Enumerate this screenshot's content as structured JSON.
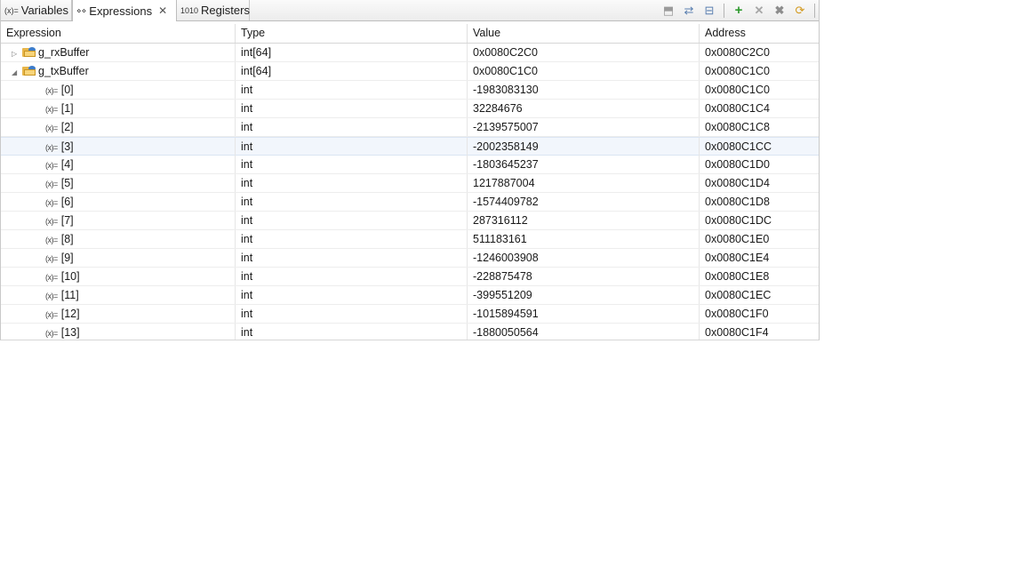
{
  "tabs": [
    {
      "label": "Variables",
      "icon": "variables-icon",
      "glyph": "(x)="
    },
    {
      "label": "Expressions",
      "icon": "expressions-icon",
      "glyph": "⋄⋄"
    },
    {
      "label": "Registers",
      "icon": "registers-icon",
      "glyph": "1010"
    }
  ],
  "toolbar_icons": [
    "collapse-all-icon",
    "show-type-names-icon",
    "collapse-icon",
    "add-expression-icon",
    "remove-icon",
    "remove-all-icon",
    "refresh-icon",
    "view-menu-icon"
  ],
  "columns": [
    "Expression",
    "Type",
    "Value",
    "Address"
  ],
  "rows": [
    {
      "expr": "g_rxBuffer",
      "type": "int[64]",
      "value": "0x0080C2C0",
      "address": "0x0080C2C0",
      "kind": "array",
      "expanded": false
    },
    {
      "expr": "g_txBuffer",
      "type": "int[64]",
      "value": "0x0080C1C0",
      "address": "0x0080C1C0",
      "kind": "array",
      "expanded": true
    },
    {
      "expr": "[0]",
      "type": "int",
      "value": "-1983083130",
      "address": "0x0080C1C0",
      "kind": "element"
    },
    {
      "expr": "[1]",
      "type": "int",
      "value": "32284676",
      "address": "0x0080C1C4",
      "kind": "element"
    },
    {
      "expr": "[2]",
      "type": "int",
      "value": "-2139575007",
      "address": "0x0080C1C8",
      "kind": "element"
    },
    {
      "expr": "[3]",
      "type": "int",
      "value": "-2002358149",
      "address": "0x0080C1CC",
      "kind": "element",
      "selected": true
    },
    {
      "expr": "[4]",
      "type": "int",
      "value": "-1803645237",
      "address": "0x0080C1D0",
      "kind": "element"
    },
    {
      "expr": "[5]",
      "type": "int",
      "value": "1217887004",
      "address": "0x0080C1D4",
      "kind": "element"
    },
    {
      "expr": "[6]",
      "type": "int",
      "value": "-1574409782",
      "address": "0x0080C1D8",
      "kind": "element"
    },
    {
      "expr": "[7]",
      "type": "int",
      "value": "287316112",
      "address": "0x0080C1DC",
      "kind": "element"
    },
    {
      "expr": "[8]",
      "type": "int",
      "value": "511183161",
      "address": "0x0080C1E0",
      "kind": "element"
    },
    {
      "expr": "[9]",
      "type": "int",
      "value": "-1246003908",
      "address": "0x0080C1E4",
      "kind": "element"
    },
    {
      "expr": "[10]",
      "type": "int",
      "value": "-228875478",
      "address": "0x0080C1E8",
      "kind": "element"
    },
    {
      "expr": "[11]",
      "type": "int",
      "value": "-399551209",
      "address": "0x0080C1EC",
      "kind": "element"
    },
    {
      "expr": "[12]",
      "type": "int",
      "value": "-1015894591",
      "address": "0x0080C1F0",
      "kind": "element"
    },
    {
      "expr": "[13]",
      "type": "int",
      "value": "-1880050564",
      "address": "0x0080C1F4",
      "kind": "element"
    }
  ]
}
